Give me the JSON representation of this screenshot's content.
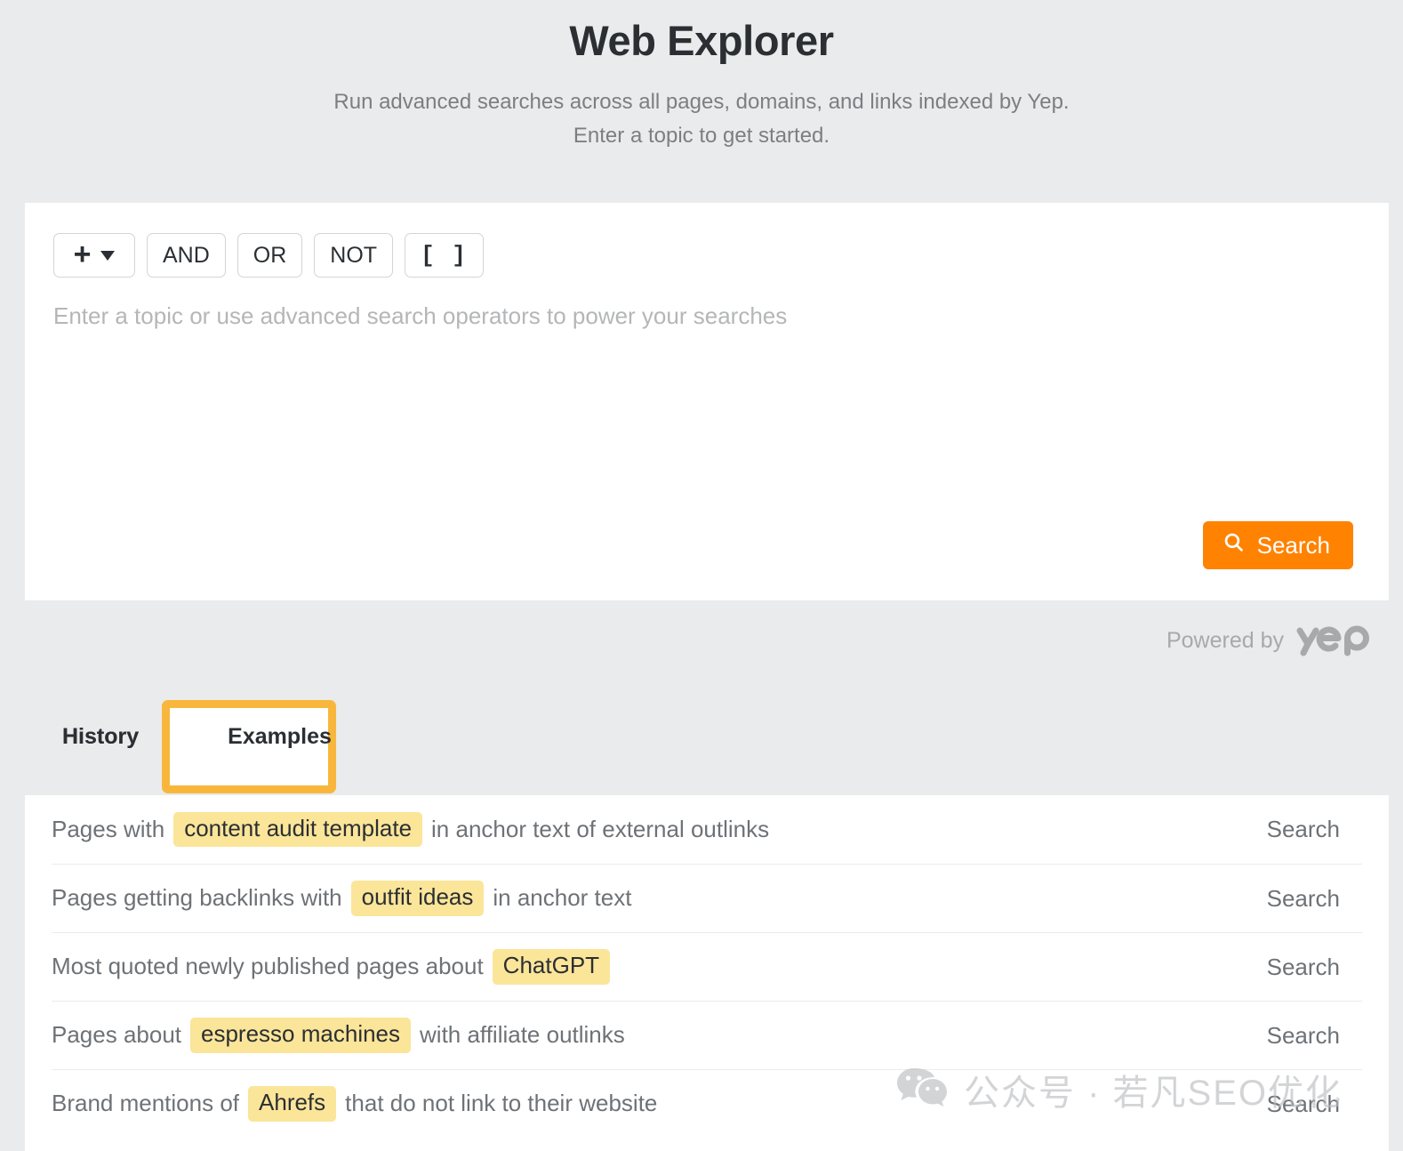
{
  "header": {
    "title": "Web Explorer",
    "subtitle_line1": "Run advanced searches across all pages, domains, and links indexed by Yep.",
    "subtitle_line2": "Enter a topic to get started."
  },
  "search_panel": {
    "operators": [
      {
        "label": "+",
        "name": "add-operator-button",
        "type": "dropdown"
      },
      {
        "label": "AND",
        "name": "and-operator-button",
        "type": "plain"
      },
      {
        "label": "OR",
        "name": "or-operator-button",
        "type": "plain"
      },
      {
        "label": "NOT",
        "name": "not-operator-button",
        "type": "plain"
      },
      {
        "label": "[ ]",
        "name": "brackets-operator-button",
        "type": "mono"
      }
    ],
    "query_value": "",
    "query_placeholder": "Enter a topic or use advanced search operators to power your searches",
    "search_button_label": "Search",
    "search_icon": "search-icon",
    "accent_color": "#ff8200"
  },
  "powered_by": {
    "label": "Powered by",
    "brand": "yep",
    "color": "#a7a9ab"
  },
  "tabs": {
    "items": [
      {
        "label": "History",
        "name": "tab-history",
        "active": false,
        "highlighted": false
      },
      {
        "label": "Examples",
        "name": "tab-examples",
        "active": true,
        "highlighted": true
      }
    ],
    "highlight_color": "#f8b73c"
  },
  "examples": {
    "row_action_label": "Search",
    "highlight_color": "#fbe599",
    "rows": [
      {
        "prefix": "Pages with",
        "chip": "content audit template",
        "suffix": "in anchor text of external outlinks",
        "action": "Search"
      },
      {
        "prefix": "Pages getting backlinks with",
        "chip": "outfit ideas",
        "suffix": "in anchor text",
        "action": "Search"
      },
      {
        "prefix": "Most quoted newly published pages about",
        "chip": "ChatGPT",
        "suffix": "",
        "action": "Search"
      },
      {
        "prefix": "Pages about",
        "chip": "espresso machines",
        "suffix": "with affiliate outlinks",
        "action": "Search"
      },
      {
        "prefix": "Brand mentions of",
        "chip": "Ahrefs",
        "suffix": "that do not link to their website",
        "action": "Search"
      }
    ]
  },
  "watermark": {
    "icon": "wechat-icon",
    "text": "公众号 · 若凡SEO优化"
  }
}
